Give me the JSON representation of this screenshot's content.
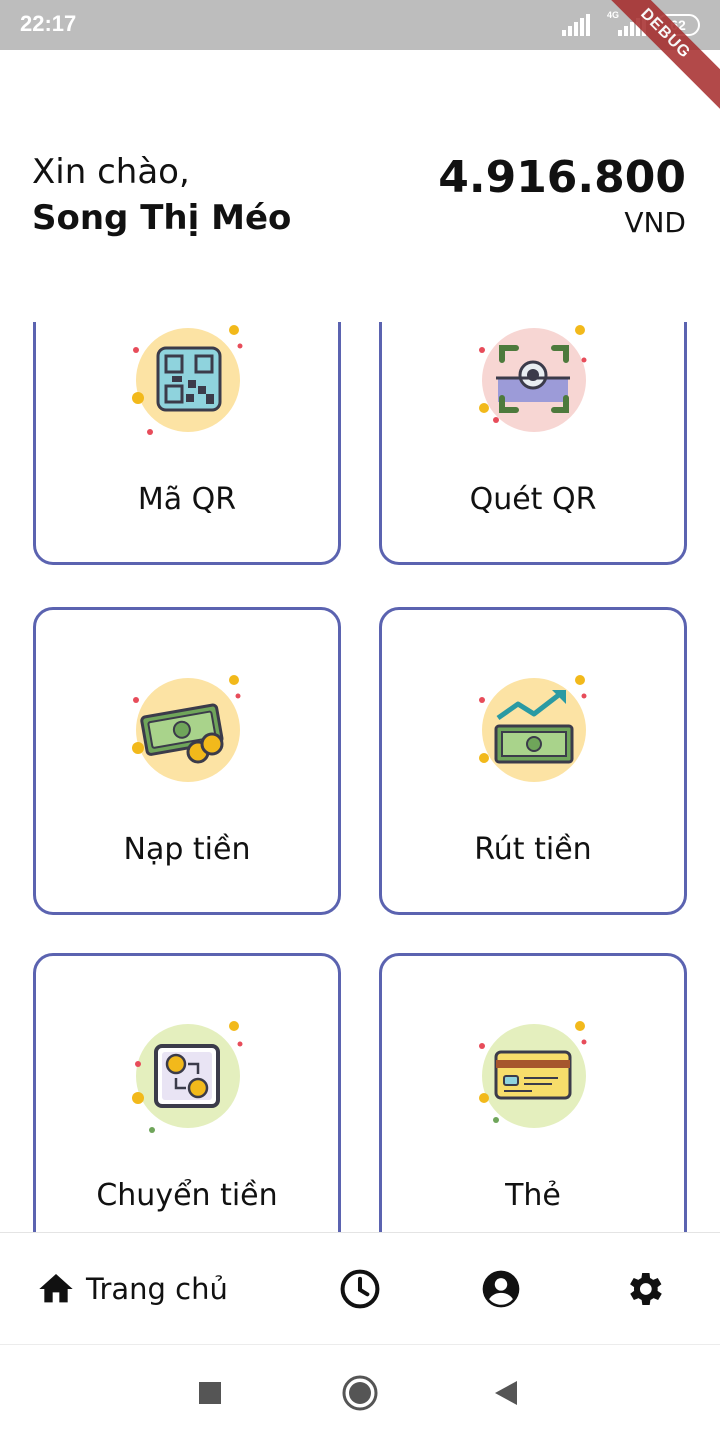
{
  "status_bar": {
    "time": "22:17",
    "network": "4G",
    "battery": "62"
  },
  "debug_banner": "DEBUG",
  "header": {
    "greeting": "Xin chào,",
    "user_name": "Song Thị Méo",
    "balance": "4.916.800",
    "currency": "VND"
  },
  "menu": [
    {
      "label": "Mã QR",
      "icon": "qr-code-icon"
    },
    {
      "label": "Quét QR",
      "icon": "scan-qr-icon"
    },
    {
      "label": "Nạp tiền",
      "icon": "deposit-money-icon"
    },
    {
      "label": "Rút tiền",
      "icon": "withdraw-money-icon"
    },
    {
      "label": "Chuyển tiền",
      "icon": "transfer-money-icon"
    },
    {
      "label": "Thẻ",
      "icon": "card-icon"
    }
  ],
  "bottom_nav": {
    "home_label": "Trang chủ",
    "items": [
      "home-icon",
      "history-clock-icon",
      "account-icon",
      "settings-gear-icon"
    ]
  },
  "colors": {
    "card_border": "#5b63b0",
    "status_bar": "#bdbdbd"
  }
}
